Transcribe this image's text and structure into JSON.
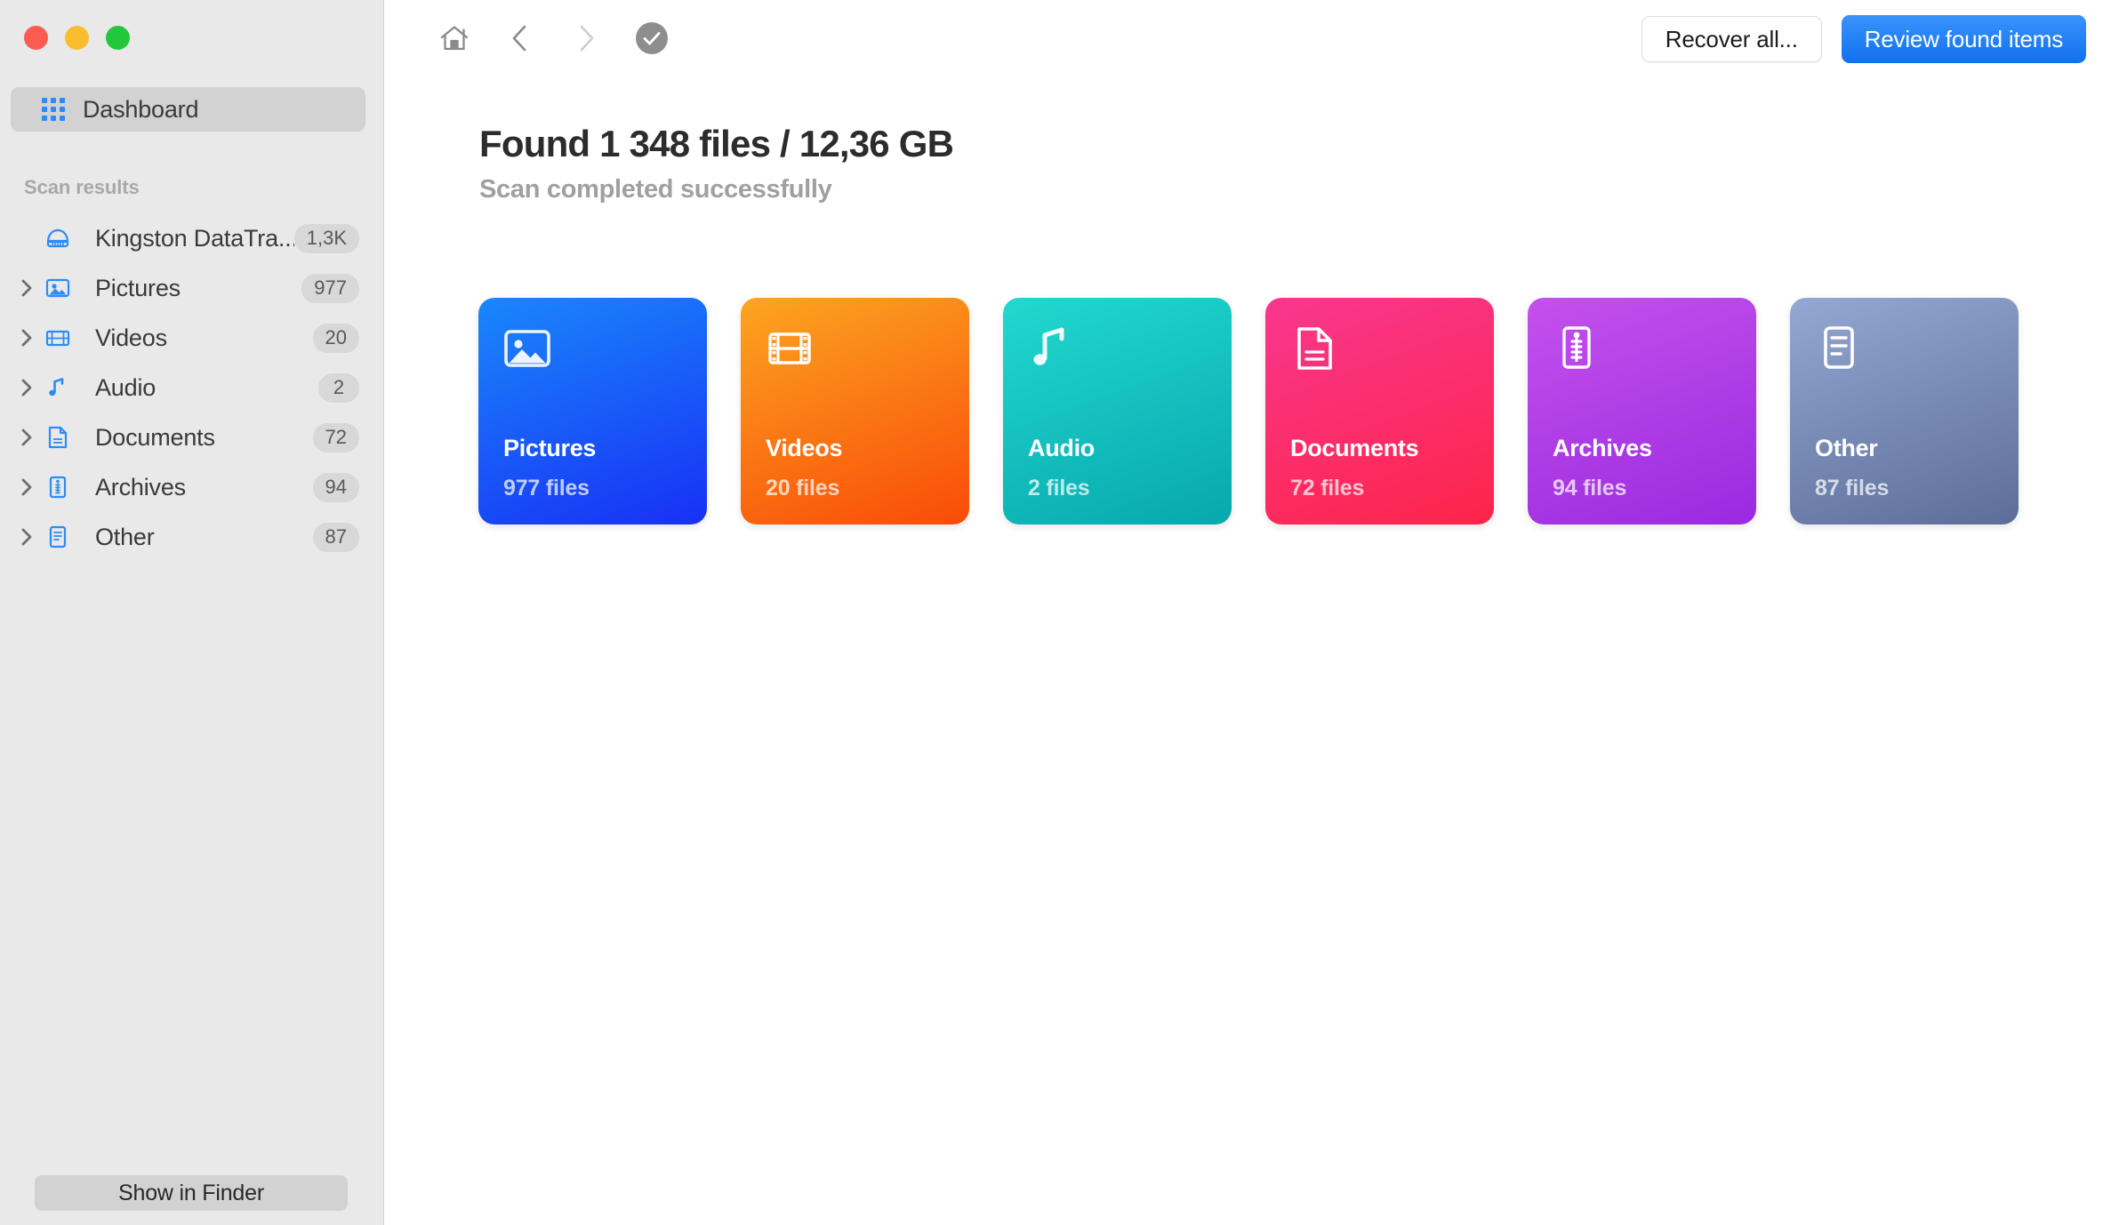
{
  "window": {
    "traffic_lights": [
      "close",
      "minimize",
      "maximize"
    ]
  },
  "sidebar": {
    "dashboard": {
      "label": "Dashboard",
      "icon": "grid-icon"
    },
    "section_title": "Scan results",
    "items": [
      {
        "label": "Kingston DataTra...",
        "badge": "1,3K",
        "icon": "disk-icon",
        "has_chevron": false
      },
      {
        "label": "Pictures",
        "badge": "977",
        "icon": "picture-icon",
        "has_chevron": true
      },
      {
        "label": "Videos",
        "badge": "20",
        "icon": "film-icon",
        "has_chevron": true
      },
      {
        "label": "Audio",
        "badge": "2",
        "icon": "music-note-icon",
        "has_chevron": true
      },
      {
        "label": "Documents",
        "badge": "72",
        "icon": "document-icon",
        "has_chevron": true
      },
      {
        "label": "Archives",
        "badge": "94",
        "icon": "archive-icon",
        "has_chevron": true
      },
      {
        "label": "Other",
        "badge": "87",
        "icon": "file-list-icon",
        "has_chevron": true
      }
    ],
    "footer_button": "Show in Finder"
  },
  "toolbar": {
    "home_icon": "home-icon",
    "back_icon": "chevron-left-icon",
    "forward_icon": "chevron-right-icon",
    "status_icon": "check-circle-icon",
    "recover_all_label": "Recover all...",
    "review_found_items_label": "Review found items"
  },
  "main": {
    "headline": "Found 1 348 files / 12,36 GB",
    "subheadline": "Scan completed successfully",
    "cards": [
      {
        "title": "Pictures",
        "subtitle": "977 files",
        "icon": "picture-icon",
        "color_from": "#1a87fb",
        "color_to": "#1830f5"
      },
      {
        "title": "Videos",
        "subtitle": "20 files",
        "icon": "film-icon",
        "color_from": "#fca521",
        "color_to": "#f94b08"
      },
      {
        "title": "Audio",
        "subtitle": "2 files",
        "icon": "music-note-icon",
        "color_from": "#22d8cf",
        "color_to": "#07a8ae"
      },
      {
        "title": "Documents",
        "subtitle": "72 files",
        "icon": "document-icon",
        "color_from": "#f9378f",
        "color_to": "#fd2449"
      },
      {
        "title": "Archives",
        "subtitle": "94 files",
        "icon": "archive-icon",
        "color_from": "#c451ec",
        "color_to": "#9a2ae0"
      },
      {
        "title": "Other",
        "subtitle": "87 files",
        "icon": "file-list-icon",
        "color_from": "#93a8d2",
        "color_to": "#5c6d99"
      }
    ]
  },
  "colors": {
    "accent": "#1a87fb",
    "sidebar_bg": "#e9e9e9",
    "selected_bg": "#d2d2d2",
    "badge_bg": "#d8d8d8"
  }
}
